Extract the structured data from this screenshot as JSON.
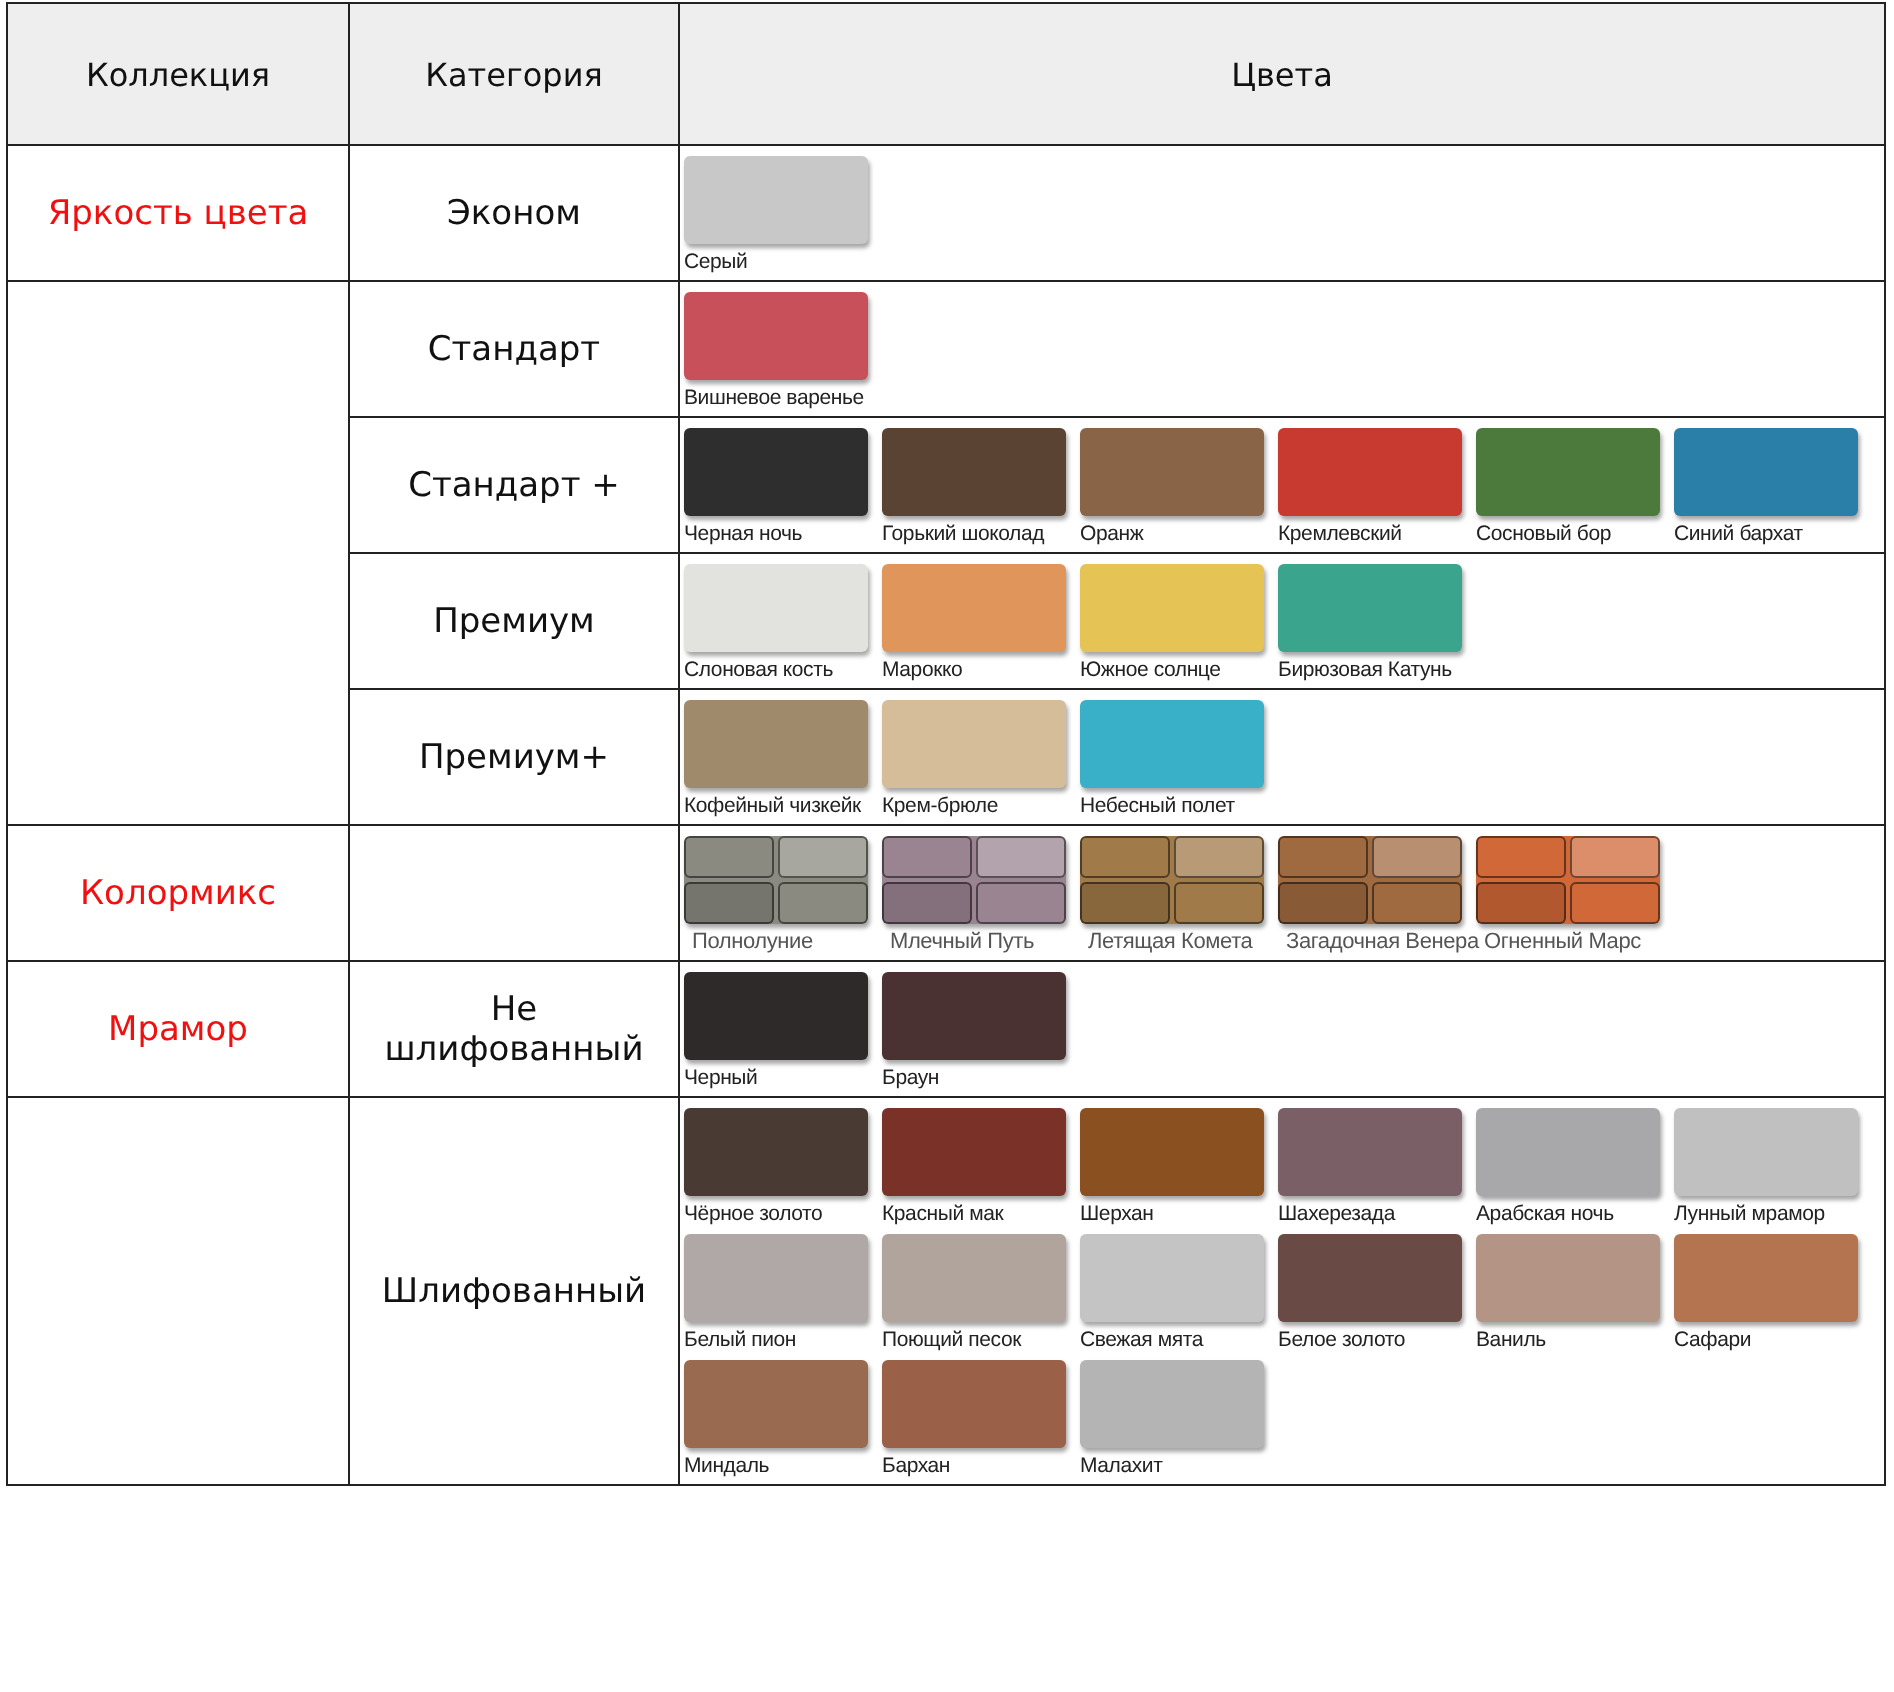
{
  "table": {
    "columns": [
      "Коллекция",
      "Категория",
      "Цвета"
    ],
    "groups": [
      {
        "collection": "Яркость цвета",
        "categories": [
          {
            "category": "Эконом",
            "swatches": [
              {
                "label": "Серый",
                "color": "#c8c8c8",
                "kind": "solid"
              }
            ]
          }
        ]
      },
      {
        "categories": [
          {
            "category": "Стандарт",
            "swatches": [
              {
                "label": "Вишневое варенье",
                "color": "#c8505a",
                "kind": "solid"
              }
            ]
          },
          {
            "category": "Стандарт +",
            "swatches": [
              {
                "label": "Черная ночь",
                "color": "#2e2e2e",
                "kind": "solid"
              },
              {
                "label": "Горький шоколад",
                "color": "#5a4332",
                "kind": "solid"
              },
              {
                "label": "Оранж",
                "color": "#8a6446",
                "kind": "solid"
              },
              {
                "label": "Кремлевский",
                "color": "#c83a30",
                "kind": "solid"
              },
              {
                "label": "Сосновый бор",
                "color": "#4c7a3c",
                "kind": "solid"
              },
              {
                "label": "Синий бархат",
                "color": "#2a7fa8",
                "kind": "solid"
              }
            ]
          },
          {
            "category": "Премиум",
            "swatches": [
              {
                "label": "Слоновая кость",
                "color": "#e2e2df",
                "kind": "solid"
              },
              {
                "label": "Марокко",
                "color": "#e0955a",
                "kind": "solid"
              },
              {
                "label": "Южное солнце",
                "color": "#e5c455",
                "kind": "solid"
              },
              {
                "label": "Бирюзовая Катунь",
                "color": "#3aa58c",
                "kind": "solid"
              }
            ]
          },
          {
            "category": "Премиум+",
            "swatches": [
              {
                "label": "Кофейный чизкейк",
                "color": "#a08a6c",
                "kind": "solid"
              },
              {
                "label": "Крем-брюле",
                "color": "#d6bd9a",
                "kind": "solid"
              },
              {
                "label": "Небесный полет",
                "color": "#3ab0c8",
                "kind": "solid"
              }
            ]
          }
        ]
      },
      {
        "collection": "Колормикс",
        "categories": [
          {
            "swatches": [
              {
                "label": "Полнолуние",
                "color": "#8a8a80",
                "kind": "mix"
              },
              {
                "label": "Млечный Путь",
                "color": "#9a8492",
                "kind": "mix"
              },
              {
                "label": "Летящая Комета",
                "color": "#a07a48",
                "kind": "mix"
              },
              {
                "label": "Загадочная Венера",
                "color": "#a06a40",
                "kind": "mix"
              },
              {
                "label": "Огненный Марс",
                "color": "#d06838",
                "kind": "mix"
              }
            ]
          }
        ]
      },
      {
        "collection": "Мрамор",
        "categories": [
          {
            "category": "Не шлифованный",
            "swatches": [
              {
                "label": "Черный",
                "color": "#2e2a2a",
                "kind": "solid"
              },
              {
                "label": "Браун",
                "color": "#4a3232",
                "kind": "solid"
              }
            ]
          }
        ]
      },
      {
        "categories": [
          {
            "category": "Шлифованный",
            "swatches": [
              {
                "label": "Чёрное золото",
                "color": "#4a3a34",
                "kind": "solid"
              },
              {
                "label": "Красный мак",
                "color": "#7a3228",
                "kind": "solid"
              },
              {
                "label": "Шерхан",
                "color": "#8a5020",
                "kind": "solid"
              },
              {
                "label": "Шахерезада",
                "color": "#7a6066",
                "kind": "solid"
              },
              {
                "label": "Арабская ночь",
                "color": "#a8a8aa",
                "kind": "solid"
              },
              {
                "label": "Лунный мрамор",
                "color": "#c0c0c0",
                "kind": "solid"
              },
              {
                "label": "Белый пион",
                "color": "#b0a8a6",
                "kind": "solid"
              },
              {
                "label": "Поющий песок",
                "color": "#b0a49c",
                "kind": "solid"
              },
              {
                "label": "Свежая мята",
                "color": "#c4c4c4",
                "kind": "solid"
              },
              {
                "label": "Белое золото",
                "color": "#6a4a44",
                "kind": "solid"
              },
              {
                "label": "Ваниль",
                "color": "#b49484",
                "kind": "solid"
              },
              {
                "label": "Сафари",
                "color": "#b47450",
                "kind": "solid"
              },
              {
                "label": "Миндаль",
                "color": "#9a6a50",
                "kind": "solid"
              },
              {
                "label": "Бархан",
                "color": "#9a6048",
                "kind": "solid"
              },
              {
                "label": "Малахит",
                "color": "#b4b4b4",
                "kind": "solid"
              }
            ]
          }
        ]
      }
    ]
  }
}
